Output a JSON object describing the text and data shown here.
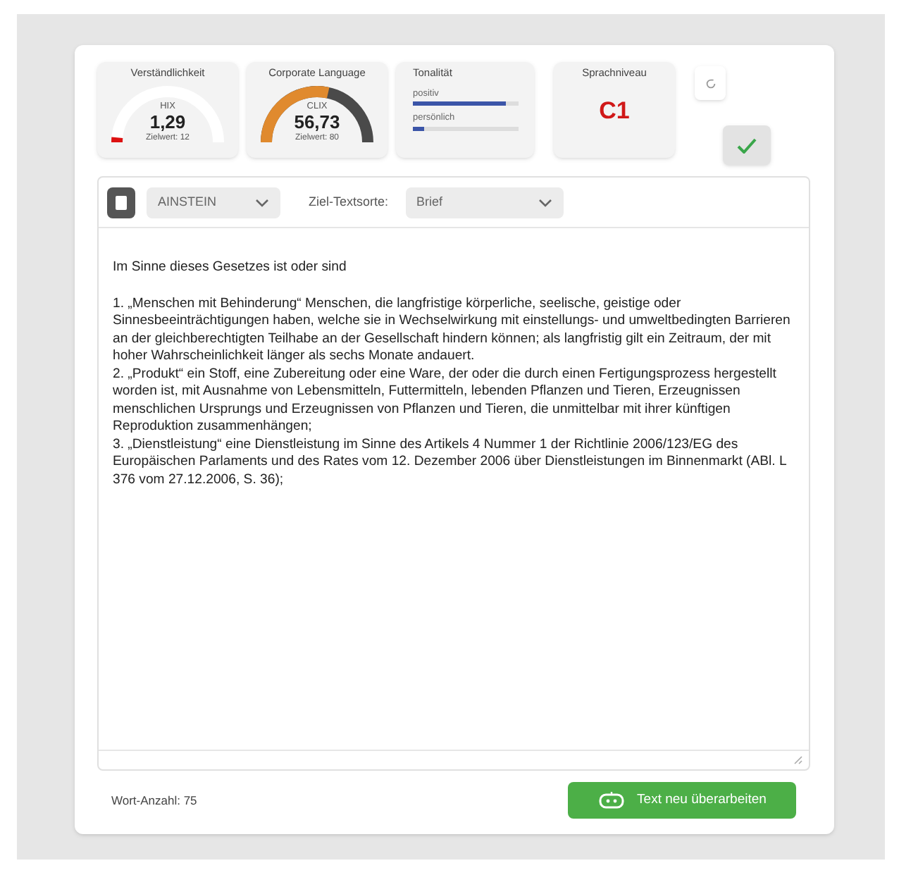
{
  "metrics": [
    {
      "kind": "gauge",
      "title": "Verständlichkeit",
      "label": "HIX",
      "value": "1,29",
      "target": "Zielwert: 12",
      "color": "#dd1111"
    },
    {
      "kind": "gauge",
      "title": "Corporate Language",
      "label": "CLIX",
      "value": "56,73",
      "target": "Zielwert: 80",
      "color": "#e08a2e"
    },
    {
      "kind": "bars",
      "title": "Tonalität",
      "bars": [
        {
          "label": "positiv",
          "level": 0.88
        },
        {
          "label": "persönlich",
          "level": 0.1
        }
      ]
    },
    {
      "kind": "grade",
      "title": "Sprachniveau",
      "value": "C1"
    }
  ],
  "toolbar": {
    "model": "AINSTEIN",
    "target_label": "Ziel-Textsorte:",
    "target": "Brief"
  },
  "text": [
    "Im Sinne dieses Gesetzes ist oder sind",
    "1.  „Menschen mit Behinderung“ Menschen, die langfristige körperliche, seelische, geistige oder Sinnesbeeinträchtigungen haben, welche sie in Wechselwirkung mit einstellungs- und umweltbedingten Barrieren an der gleichberechtigten Teilhabe an der Gesellschaft hindern können; als langfristig gilt ein Zeitraum, der mit hoher Wahrscheinlichkeit länger als sechs Monate andauert.",
    "2.  „Produkt“ ein Stoff, eine Zubereitung oder eine Ware, der oder die durch einen Fertigungsprozess hergestellt worden ist, mit Ausnahme von Lebensmitteln, Futtermitteln, lebenden Pflanzen und Tieren, Erzeugnissen menschlichen Ursprungs und Erzeugnissen von Pflanzen und Tieren, die unmittelbar mit ihrer künftigen Reproduktion zusammenhängen;",
    "3.  „Dienstleistung“ eine Dienstleistung im Sinne des Artikels 4 Nummer 1 der Richtlinie 2006/123/EG des Europäischen Parlaments und des Rates vom 12. Dezember 2006 über Dienstleistungen im Binnenmarkt (ABl. L 376 vom 27.12.2006, S. 36);"
  ],
  "word_count": "Wort-Anzahl: 75",
  "rewrite_button": "Text neu überarbeiten"
}
